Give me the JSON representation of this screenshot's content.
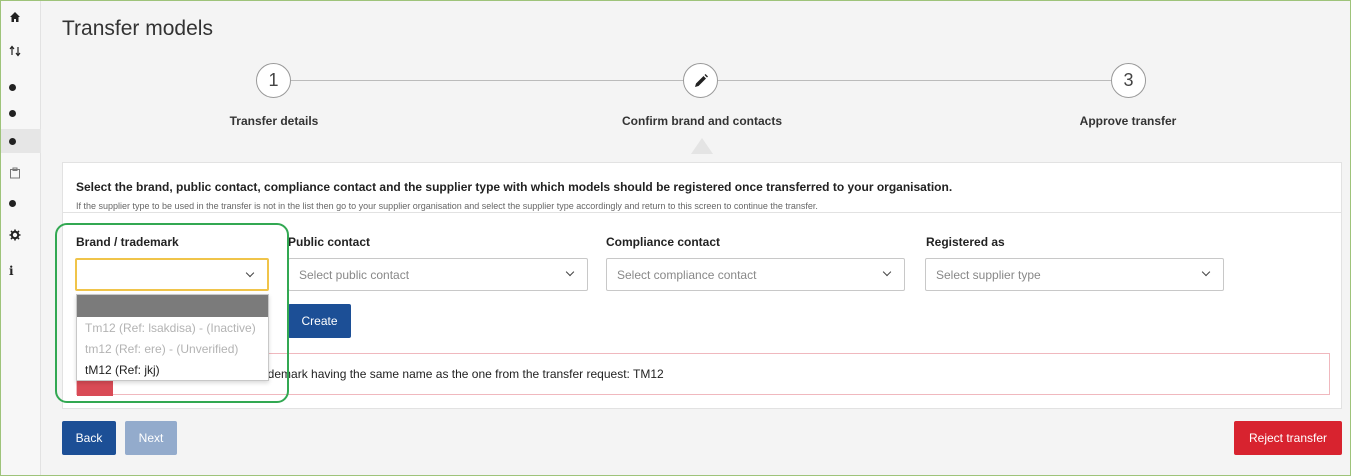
{
  "page": {
    "title": "Transfer models"
  },
  "sidebar": {
    "items": [
      {
        "icon": "home-icon"
      },
      {
        "icon": "sort-arrows-icon"
      },
      {
        "icon": "dot-icon"
      },
      {
        "icon": "dot-icon"
      },
      {
        "icon": "dot-icon",
        "active": true
      },
      {
        "icon": "clipboard-icon"
      },
      {
        "icon": "dot-icon"
      },
      {
        "icon": "gear-icon"
      },
      {
        "icon": "info-icon"
      }
    ]
  },
  "stepper": {
    "steps": [
      {
        "number": "1",
        "label": "Transfer details"
      },
      {
        "number": "",
        "icon": "pencil-icon",
        "label": "Confirm brand and contacts"
      },
      {
        "number": "3",
        "label": "Approve transfer"
      }
    ]
  },
  "panel": {
    "title": "Select the brand, public contact, compliance contact and the supplier type with which models should be registered once transferred to your organisation.",
    "note": "If the supplier type to be used in the transfer is not in the list then go to your supplier organisation and select the supplier type accordingly and return to this screen to continue the transfer."
  },
  "fields": {
    "brand": {
      "label": "Brand / trademark",
      "value": ""
    },
    "public_contact": {
      "label": "Public contact",
      "placeholder": "Select public contact"
    },
    "compliance_contact": {
      "label": "Compliance contact",
      "placeholder": "Select compliance contact"
    },
    "registered_as": {
      "label": "Registered as",
      "placeholder": "Select supplier type"
    }
  },
  "buttons": {
    "create": "Create",
    "back": "Back",
    "next": "Next",
    "reject": "Reject transfer"
  },
  "alert": {
    "text": "d / trademark having the same name as the one from the transfer request: TM12"
  },
  "dropdown": {
    "options": [
      {
        "label": "",
        "state": "highlighted"
      },
      {
        "label": "Tm12 (Ref: lsakdisa) - (Inactive)",
        "state": "disabled"
      },
      {
        "label": "tm12 (Ref: ere) - (Unverified)",
        "state": "disabled"
      },
      {
        "label": "tM12 (Ref: jkj)",
        "state": "enabled"
      }
    ]
  },
  "colors": {
    "primary": "#1c4f96",
    "danger": "#d8232f",
    "highlight": "#32a852",
    "focus": "#f0c44a"
  }
}
